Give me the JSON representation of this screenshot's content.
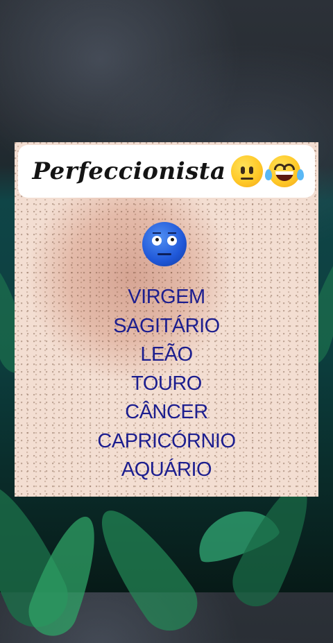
{
  "post": {
    "title": "Perfeccionista",
    "title_emojis": [
      "neutral-face-icon",
      "tears-of-joy-icon"
    ],
    "center_icon": "blue-neutral-face-icon",
    "signs": [
      "VIRGEM",
      "SAGITÁRIO",
      "LEÃO",
      "TOURO",
      "CÂNCER",
      "CAPRICÓRNIO",
      "AQUÁRIO"
    ]
  },
  "colors": {
    "sign_text": "#1c1e8f",
    "card_background": "#f3ded2",
    "title_bar": "#ffffff"
  }
}
